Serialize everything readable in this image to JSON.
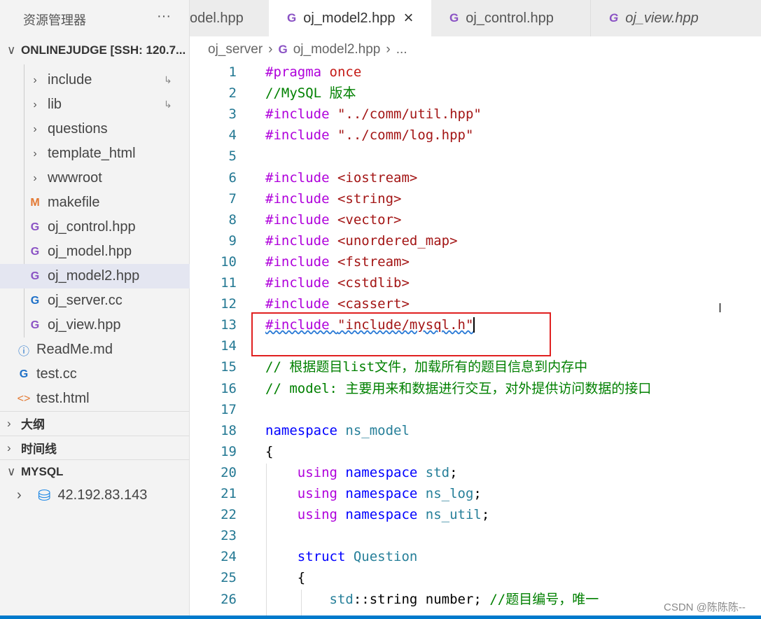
{
  "sidebar": {
    "title": "资源管理器",
    "more": "···",
    "workspace": "ONLINEJUDGE [SSH: 120.7...",
    "items": [
      {
        "label": "include",
        "icon": "chevron-right",
        "arrow": "↳"
      },
      {
        "label": "lib",
        "icon": "chevron-right",
        "arrow": "↳"
      },
      {
        "label": "questions",
        "icon": "chevron-right"
      },
      {
        "label": "template_html",
        "icon": "chevron-right"
      },
      {
        "label": "wwwroot",
        "icon": "chevron-right"
      },
      {
        "label": "makefile",
        "icon": "M"
      },
      {
        "label": "oj_control.hpp",
        "icon": "C+"
      },
      {
        "label": "oj_model.hpp",
        "icon": "C+"
      },
      {
        "label": "oj_model2.hpp",
        "icon": "C+",
        "selected": true
      },
      {
        "label": "oj_server.cc",
        "icon": "C+"
      },
      {
        "label": "oj_view.hpp",
        "icon": "C+"
      },
      {
        "label": "ReadMe.md",
        "icon": "info"
      },
      {
        "label": "test.cc",
        "icon": "C+"
      },
      {
        "label": "test.html",
        "icon": "<>"
      }
    ],
    "sections": [
      "大纲",
      "时间线",
      "MYSQL"
    ],
    "mysql_host": "42.192.83.143"
  },
  "tabs": [
    {
      "label": "odel.hpp"
    },
    {
      "label": "oj_model2.hpp",
      "active": true,
      "close": "×"
    },
    {
      "label": "oj_control.hpp"
    },
    {
      "label": "oj_view.hpp"
    }
  ],
  "breadcrumb": [
    "oj_server",
    "oj_model2.hpp",
    "..."
  ],
  "code": [
    [
      [
        "#pragma ",
        "kw"
      ],
      [
        "once",
        "red"
      ]
    ],
    [
      [
        "//MySQL 版本",
        "cm"
      ]
    ],
    [
      [
        "#include ",
        "kw"
      ],
      [
        "\"../comm/util.hpp\"",
        "str"
      ]
    ],
    [
      [
        "#include ",
        "kw"
      ],
      [
        "\"../comm/log.hpp\"",
        "str"
      ]
    ],
    [],
    [
      [
        "#include ",
        "kw"
      ],
      [
        "<iostream>",
        "str"
      ]
    ],
    [
      [
        "#include ",
        "kw"
      ],
      [
        "<string>",
        "str"
      ]
    ],
    [
      [
        "#include ",
        "kw"
      ],
      [
        "<vector>",
        "str"
      ]
    ],
    [
      [
        "#include ",
        "kw"
      ],
      [
        "<unordered_map>",
        "str"
      ]
    ],
    [
      [
        "#include ",
        "kw"
      ],
      [
        "<fstream>",
        "str"
      ]
    ],
    [
      [
        "#include ",
        "kw"
      ],
      [
        "<cstdlib>",
        "str"
      ]
    ],
    [
      [
        "#include ",
        "kw"
      ],
      [
        "<cassert>",
        "str"
      ]
    ],
    [
      [
        "#include ",
        "kw squig"
      ],
      [
        "\"include/mysql.h\"",
        "str squig"
      ]
    ],
    [],
    [
      [
        "// 根据题目list文件，加载所有的题目信息到内存中",
        "cm"
      ]
    ],
    [
      [
        "// model: 主要用来和数据进行交互，对外提供访问数据的接口",
        "cm"
      ]
    ],
    [],
    [
      [
        "namespace ",
        "blue"
      ],
      [
        "ns_model",
        "ty"
      ]
    ],
    [
      [
        "{",
        "pl"
      ]
    ],
    [
      [
        "    using ",
        "kw"
      ],
      [
        "namespace ",
        "blue"
      ],
      [
        "std",
        "ty"
      ],
      [
        ";",
        "pl"
      ]
    ],
    [
      [
        "    using ",
        "kw"
      ],
      [
        "namespace ",
        "blue"
      ],
      [
        "ns_log",
        "ty"
      ],
      [
        ";",
        "pl"
      ]
    ],
    [
      [
        "    using ",
        "kw"
      ],
      [
        "namespace ",
        "blue"
      ],
      [
        "ns_util",
        "ty"
      ],
      [
        ";",
        "pl"
      ]
    ],
    [],
    [
      [
        "    struct ",
        "blue"
      ],
      [
        "Question",
        "ty"
      ]
    ],
    [
      [
        "    {",
        "pl"
      ]
    ],
    [
      [
        "        std",
        "ty"
      ],
      [
        "::string number; ",
        "pl"
      ],
      [
        "//题目编号，唯一",
        "cm"
      ]
    ]
  ],
  "watermark": "CSDN @陈陈陈--",
  "cursor_glyph": "I"
}
